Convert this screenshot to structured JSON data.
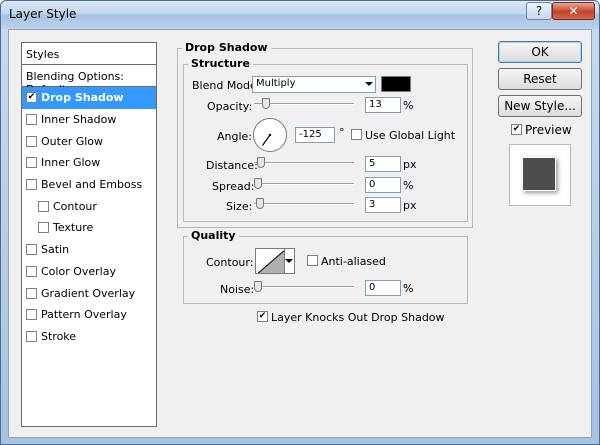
{
  "window": {
    "title": "Layer Style",
    "help_label": "?",
    "close_label": "✕"
  },
  "sidebar": {
    "header": "Styles",
    "blending_options": "Blending Options: Default",
    "items": [
      {
        "label": "Drop Shadow",
        "checked": true,
        "selected": true,
        "indent": false
      },
      {
        "label": "Inner Shadow",
        "checked": false,
        "selected": false,
        "indent": false
      },
      {
        "label": "Outer Glow",
        "checked": false,
        "selected": false,
        "indent": false
      },
      {
        "label": "Inner Glow",
        "checked": false,
        "selected": false,
        "indent": false
      },
      {
        "label": "Bevel and Emboss",
        "checked": false,
        "selected": false,
        "indent": false
      },
      {
        "label": "Contour",
        "checked": false,
        "selected": false,
        "indent": true
      },
      {
        "label": "Texture",
        "checked": false,
        "selected": false,
        "indent": true
      },
      {
        "label": "Satin",
        "checked": false,
        "selected": false,
        "indent": false
      },
      {
        "label": "Color Overlay",
        "checked": false,
        "selected": false,
        "indent": false
      },
      {
        "label": "Gradient Overlay",
        "checked": false,
        "selected": false,
        "indent": false
      },
      {
        "label": "Pattern Overlay",
        "checked": false,
        "selected": false,
        "indent": false
      },
      {
        "label": "Stroke",
        "checked": false,
        "selected": false,
        "indent": false
      }
    ]
  },
  "drop_shadow": {
    "section_title": "Drop Shadow",
    "structure_title": "Structure",
    "blend_mode_label": "Blend Mode:",
    "blend_mode_value": "Multiply",
    "shadow_color": "#000000",
    "opacity_label": "Opacity:",
    "opacity_value": "13",
    "opacity_unit": "%",
    "angle_label": "Angle:",
    "angle_value": "-125",
    "angle_unit": "°",
    "use_global_light_label": "Use Global Light",
    "use_global_light_checked": false,
    "distance_label": "Distance:",
    "distance_value": "5",
    "distance_unit": "px",
    "spread_label": "Spread:",
    "spread_value": "0",
    "spread_unit": "%",
    "size_label": "Size:",
    "size_value": "3",
    "size_unit": "px",
    "quality_title": "Quality",
    "contour_label": "Contour:",
    "anti_aliased_label": "Anti-aliased",
    "anti_aliased_checked": false,
    "noise_label": "Noise:",
    "noise_value": "0",
    "noise_unit": "%",
    "knockout_label": "Layer Knocks Out Drop Shadow",
    "knockout_checked": true
  },
  "buttons": {
    "ok": "OK",
    "reset": "Reset",
    "new_style": "New Style...",
    "preview_label": "Preview",
    "preview_checked": true
  },
  "colors": {
    "selection": "#3399ff",
    "shadow": "#000000"
  }
}
